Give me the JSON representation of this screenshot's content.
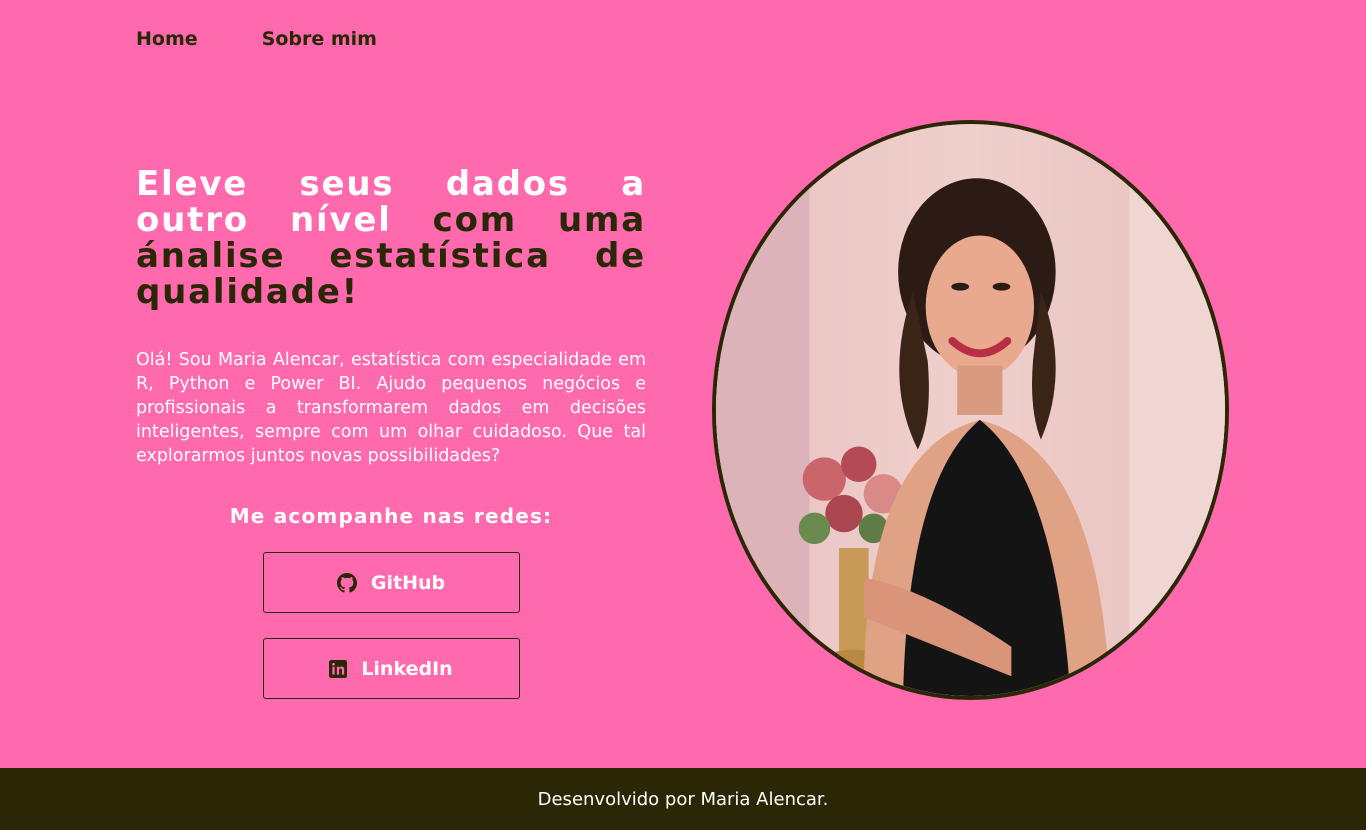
{
  "nav": {
    "home_label": "Home",
    "about_label": "Sobre mim"
  },
  "hero": {
    "headline_part1": "Eleve seus dados a outro nível",
    "headline_part2": " com uma ánalise estatística de qualidade!",
    "intro": "Olá! Sou Maria Alencar, estatística com especialidade em R, Python e Power BI. Ajudo pequenos negócios e profissionais a transformarem dados em decisões inteligentes, sempre com um olhar cuidadoso. Que tal explorarmos juntos novas possibilidades?",
    "follow_label": "Me acompanhe nas redes:"
  },
  "socials": [
    {
      "label": "GitHub",
      "icon": "github-icon"
    },
    {
      "label": "LinkedIn",
      "icon": "linkedin-icon"
    }
  ],
  "footer": {
    "text": "Desenvolvido por Maria Alencar."
  },
  "colors": {
    "background": "#ff69ad",
    "dark": "#2a2706",
    "light": "#ffffff"
  }
}
